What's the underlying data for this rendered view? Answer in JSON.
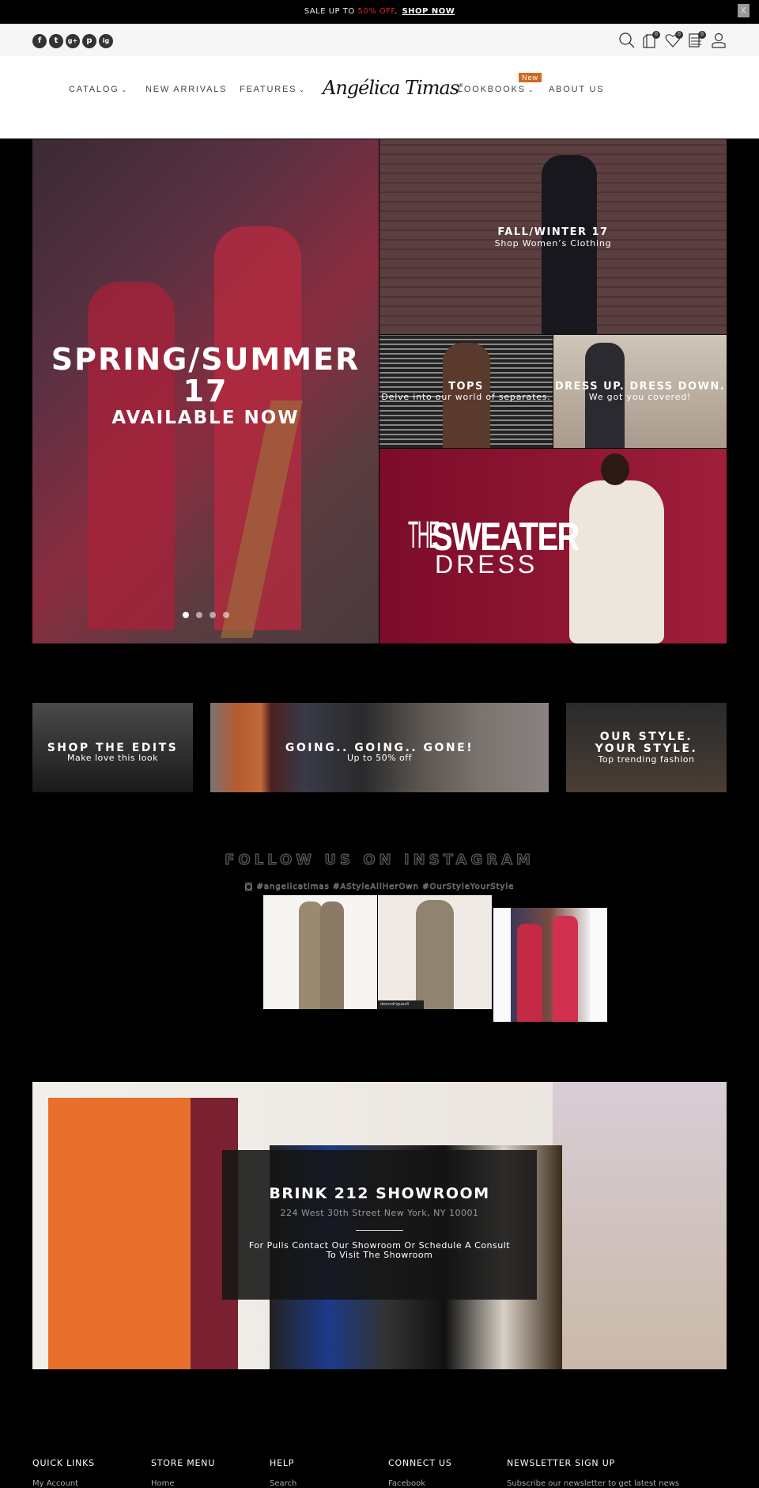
{
  "announcement": {
    "prefix": "SALE UP TO ",
    "highlight": "50% OFF",
    "suffix": ".",
    "link": "SHOP NOW",
    "close": "X",
    "highlight_color": "#dd2222"
  },
  "social": [
    "f",
    "t",
    "g+",
    "p",
    "ig"
  ],
  "utility_icons": [
    {
      "name": "search-icon"
    },
    {
      "name": "cart-icon",
      "count": "0"
    },
    {
      "name": "wishlist-icon",
      "count": "0"
    },
    {
      "name": "compare-icon",
      "count": "0"
    },
    {
      "name": "account-icon"
    }
  ],
  "nav": {
    "catalog": "CATALOG",
    "new_arrivals": "NEW ARRIVALS",
    "features": "FEATURES",
    "logo": "Angélica Timas",
    "logo_mark": "®",
    "lookbooks": "LOOKBOOKS",
    "lookbooks_badge": "New",
    "about": "ABOUT US",
    "chevron": "⌄",
    "badge_color": "#d2691e"
  },
  "hero": {
    "slide_title_1": "SPRING/SUMMER",
    "slide_title_2": "17",
    "slide_subtitle": "AVAILABLE NOW",
    "dots_total": 4,
    "dots_active": 1,
    "tiles": {
      "fall_title": "FALL/WINTER 17",
      "fall_sub": "Shop Women’s Clothing",
      "tops_title": "TOPS",
      "tops_sub": "Delve into our world of separates.",
      "dress_title": "DRESS UP. DRESS DOWN.",
      "dress_sub": "We got you covered!",
      "sweater_the": "THE",
      "sweater_word": "SWEATER",
      "sweater_dress": "DRESS"
    }
  },
  "banners": [
    {
      "title": "SHOP THE EDITS",
      "sub": "Make love this look"
    },
    {
      "title": "GOING.. GOING.. GONE!",
      "sub": "Up to 50% off"
    },
    {
      "title": "OUR STYLE. YOUR STYLE.",
      "sub": "Top trending fashion"
    }
  ],
  "instagram": {
    "title": "FOLLOW US ON INSTAGRAM",
    "tags": "#angelicatimas #AStyleAllHerOwn #OurStyleYourStyle",
    "photo_credit": "deerodrigues4"
  },
  "showroom": {
    "title": "BRINK 212 SHOWROOM",
    "address": "224 West 30th Street New York, NY 10001",
    "cta_line1": "For Pulls Contact Our Showroom Or Schedule A Consult",
    "cta_line2": "To Visit The Showroom"
  },
  "footer": {
    "headings": [
      "QUICK LINKS",
      "STORE MENU",
      "HELP",
      "CONNECT US",
      "NEWSLETTER SIGN UP"
    ],
    "first_items": [
      "My Account",
      "Home",
      "Search",
      "Facebook",
      "Subscribe our newsletter to get latest news"
    ]
  }
}
